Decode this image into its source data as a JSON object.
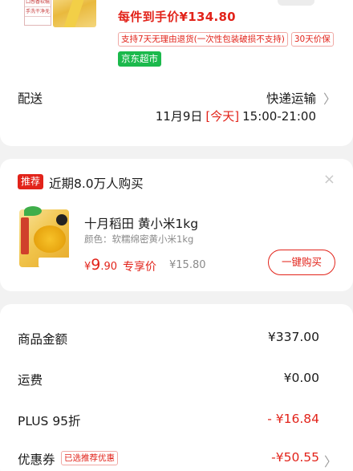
{
  "product_summary": {
    "thumb_tags": [
      "口感香软糯",
      "手洗干净无"
    ],
    "price_line": "每件到手价¥134.80",
    "service_badges": [
      "支持7天无理由退货(一次性包装破损不支持)",
      "30天价保"
    ],
    "store_badge": "京东超市"
  },
  "delivery": {
    "label": "配送",
    "method": "快递运输",
    "arrow": "〉",
    "date": "11月9日",
    "today": "[今天]",
    "time": "15:00-21:00"
  },
  "recommendation": {
    "badge": "推荐",
    "title": "近期8.0万人购买",
    "close": "×",
    "product": {
      "name": "十月稻田 黄小米1kg",
      "variant": "颜色：软糯绵密黄小米1kg",
      "currency": "¥",
      "price_int": "9",
      "price_dec": ".90",
      "price_label": "专享价",
      "original_price": "¥15.80",
      "buy_label": "一键购买"
    }
  },
  "summary": {
    "rows": [
      {
        "label": "商品金额",
        "value": "¥337.00"
      },
      {
        "label": "运费",
        "value": "¥0.00"
      },
      {
        "label": "PLUS 95折",
        "value": "- ¥16.84"
      },
      {
        "label": "优惠券",
        "value": "-¥50.55"
      }
    ],
    "coupon_tag": "已选推荐优惠",
    "arrow": "〉"
  },
  "colors": {
    "accent": "#e2231a",
    "store_green": "#1bb94c",
    "background": "#f2f2f2"
  }
}
